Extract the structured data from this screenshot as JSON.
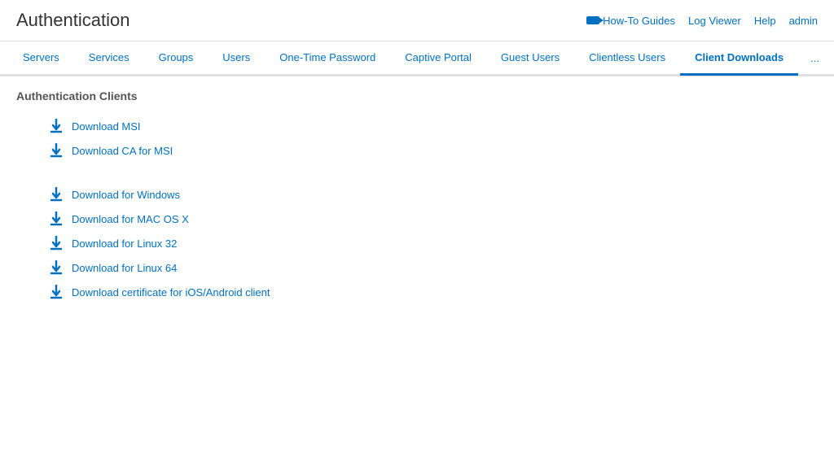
{
  "header": {
    "title": "Authentication",
    "nav": {
      "how_to_guides": "How-To Guides",
      "log_viewer": "Log Viewer",
      "help": "Help",
      "admin": "admin"
    }
  },
  "tabs": [
    {
      "label": "Servers",
      "active": false
    },
    {
      "label": "Services",
      "active": false
    },
    {
      "label": "Groups",
      "active": false
    },
    {
      "label": "Users",
      "active": false
    },
    {
      "label": "One-Time Password",
      "active": false
    },
    {
      "label": "Captive Portal",
      "active": false
    },
    {
      "label": "Guest Users",
      "active": false
    },
    {
      "label": "Clientless Users",
      "active": false
    },
    {
      "label": "Client Downloads",
      "active": true
    }
  ],
  "more_label": "...",
  "section_title": "Authentication Clients",
  "downloads": [
    {
      "group": 1,
      "items": [
        {
          "label": "Download MSI"
        },
        {
          "label": "Download CA for MSI"
        }
      ]
    },
    {
      "group": 2,
      "items": [
        {
          "label": "Download for Windows"
        },
        {
          "label": "Download for MAC OS X"
        },
        {
          "label": "Download for Linux 32"
        },
        {
          "label": "Download for Linux 64"
        },
        {
          "label": "Download certificate for iOS/Android client"
        }
      ]
    }
  ]
}
